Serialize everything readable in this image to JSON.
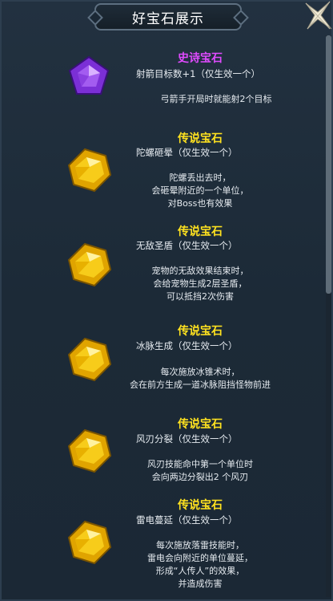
{
  "dialog": {
    "title": "好宝石展示"
  },
  "gems": [
    {
      "icon": "purple-gem-icon",
      "rarity": "史诗宝石",
      "subtitle": "射箭目标数+1（仅生效一个）",
      "desc": [
        "弓箭手开局时就能射2个目标"
      ]
    },
    {
      "icon": "gold-gem-icon",
      "rarity": "传说宝石",
      "subtitle": "陀螺砸晕（仅生效一个）",
      "desc": [
        "陀螺丢出去时，",
        "会砸晕附近的一个单位，",
        "对Boss也有效果"
      ]
    },
    {
      "icon": "gold-gem-icon",
      "rarity": "传说宝石",
      "subtitle": "无敌圣盾（仅生效一个）",
      "desc": [
        "宠物的无敌效果结束时，",
        "会给宠物生成2层圣盾，",
        "可以抵挡2次伤害"
      ]
    },
    {
      "icon": "gold-gem-icon",
      "rarity": "传说宝石",
      "subtitle": "冰脉生成（仅生效一个）",
      "desc": [
        "每次施放冰锥术时，",
        "会在前方生成一道冰脉阻挡怪物前进"
      ]
    },
    {
      "icon": "gold-gem-icon",
      "rarity": "传说宝石",
      "subtitle": "风刃分裂（仅生效一个）",
      "desc": [
        "风刃技能命中第一个单位时",
        "会向两边分裂出2 个风刃"
      ]
    },
    {
      "icon": "gold-gem-icon",
      "rarity": "传说宝石",
      "subtitle": "雷电蔓延（仅生效一个）",
      "desc": [
        "每次施放落雷技能时，",
        "雷电会向附近的单位蔓延，",
        "形成“人传人”的效果，",
        "并造成伤害"
      ]
    }
  ],
  "colors": {
    "epic": "#e04bff",
    "legend": "#ffe21f"
  }
}
